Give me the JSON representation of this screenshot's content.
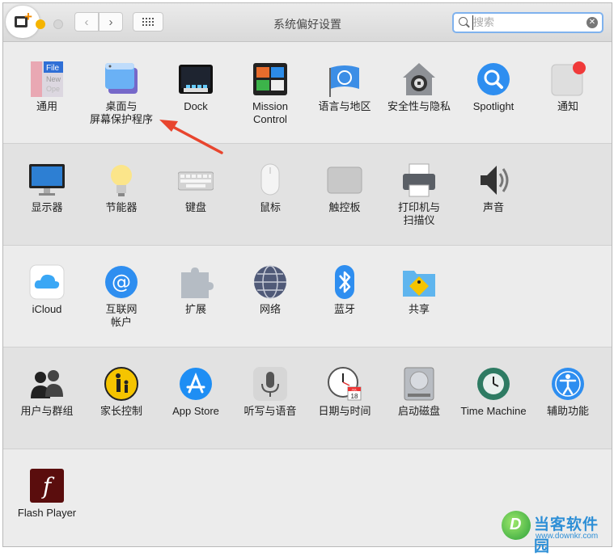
{
  "window": {
    "title": "系统偏好设置"
  },
  "toolbar": {
    "back_glyph": "‹",
    "forward_glyph": "›",
    "show_all_icon": "grid-icon"
  },
  "search": {
    "placeholder": "搜索",
    "value": ""
  },
  "rows": [
    {
      "items": [
        {
          "key": "general",
          "label": "通用",
          "icon": "general-icon"
        },
        {
          "key": "desktop",
          "label": "桌面与\n屏幕保护程序",
          "icon": "desktop-icon"
        },
        {
          "key": "dock",
          "label": "Dock",
          "icon": "dock-icon"
        },
        {
          "key": "mission-control",
          "label": "Mission\nControl",
          "icon": "mission-control-icon"
        },
        {
          "key": "language",
          "label": "语言与地区",
          "icon": "un-flag-icon"
        },
        {
          "key": "security",
          "label": "安全性与隐私",
          "icon": "house-lock-icon"
        },
        {
          "key": "spotlight",
          "label": "Spotlight",
          "icon": "spotlight-icon"
        },
        {
          "key": "notifications",
          "label": "通知",
          "icon": "notifications-icon"
        }
      ]
    },
    {
      "items": [
        {
          "key": "displays",
          "label": "显示器",
          "icon": "display-icon"
        },
        {
          "key": "energy",
          "label": "节能器",
          "icon": "lightbulb-icon"
        },
        {
          "key": "keyboard",
          "label": "键盘",
          "icon": "keyboard-icon"
        },
        {
          "key": "mouse",
          "label": "鼠标",
          "icon": "mouse-icon"
        },
        {
          "key": "trackpad",
          "label": "触控板",
          "icon": "trackpad-icon"
        },
        {
          "key": "printers",
          "label": "打印机与\n扫描仪",
          "icon": "printer-icon"
        },
        {
          "key": "sound",
          "label": "声音",
          "icon": "speaker-icon"
        }
      ]
    },
    {
      "items": [
        {
          "key": "icloud",
          "label": "iCloud",
          "icon": "icloud-icon"
        },
        {
          "key": "internet-accounts",
          "label": "互联网\n帐户",
          "icon": "at-sign-icon"
        },
        {
          "key": "extensions",
          "label": "扩展",
          "icon": "puzzle-icon"
        },
        {
          "key": "network",
          "label": "网络",
          "icon": "globe-icon"
        },
        {
          "key": "bluetooth",
          "label": "蓝牙",
          "icon": "bluetooth-icon"
        },
        {
          "key": "sharing",
          "label": "共享",
          "icon": "sharing-folder-icon"
        }
      ]
    },
    {
      "items": [
        {
          "key": "users",
          "label": "用户与群组",
          "icon": "users-icon"
        },
        {
          "key": "parental",
          "label": "家长控制",
          "icon": "parental-controls-icon"
        },
        {
          "key": "appstore",
          "label": "App Store",
          "icon": "app-store-icon"
        },
        {
          "key": "dictation",
          "label": "听写与语音",
          "icon": "microphone-icon"
        },
        {
          "key": "datetime",
          "label": "日期与时间",
          "icon": "clock-calendar-icon"
        },
        {
          "key": "startup",
          "label": "启动磁盘",
          "icon": "hard-disk-icon"
        },
        {
          "key": "timemachine",
          "label": "Time Machine",
          "icon": "time-machine-icon"
        },
        {
          "key": "accessibility",
          "label": "辅助功能",
          "icon": "accessibility-icon"
        }
      ]
    },
    {
      "items": [
        {
          "key": "flash",
          "label": "Flash Player",
          "icon": "flash-icon"
        }
      ]
    }
  ],
  "icon_text": {
    "general_file": "File",
    "general_new": "New",
    "general_open": "Ope",
    "at_sign": "@",
    "calendar_month": "JUL",
    "calendar_day": "18",
    "flash_letter": "f"
  },
  "watermark": {
    "title": "当客软件园",
    "url": "www.downkr.com"
  },
  "colors": {
    "accent": "#3d8ef0",
    "arrow": "#e8452e",
    "search_focus": "#7fb2ee"
  }
}
